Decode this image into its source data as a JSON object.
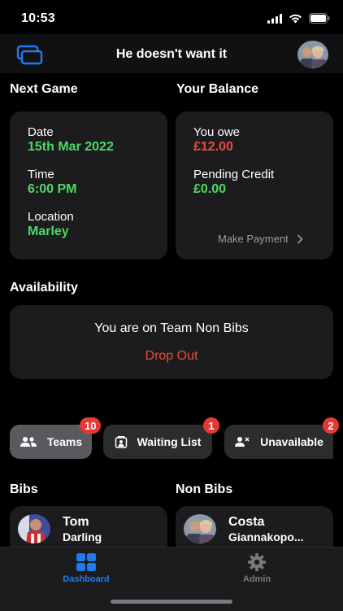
{
  "status": {
    "time": "10:53"
  },
  "header": {
    "title": "He doesn't want it"
  },
  "next_game": {
    "title": "Next Game",
    "date_label": "Date",
    "date_value": "15th Mar 2022",
    "time_label": "Time",
    "time_value": "6:00 PM",
    "location_label": "Location",
    "location_value": "Marley"
  },
  "balance": {
    "title": "Your Balance",
    "owe_label": "You owe",
    "owe_value": "£12.00",
    "credit_label": "Pending Credit",
    "credit_value": "£0.00",
    "make_payment": "Make Payment"
  },
  "availability": {
    "title": "Availability",
    "team_text": "You are on Team Non Bibs",
    "drop_out": "Drop Out"
  },
  "chips": [
    {
      "label": "Teams",
      "badge": "10",
      "icon": "people-icon"
    },
    {
      "label": "Waiting List",
      "badge": "1",
      "icon": "waiting-list-icon"
    },
    {
      "label": "Unavailable",
      "badge": "2",
      "icon": "person-unavailable-icon"
    }
  ],
  "teams": {
    "bibs_title": "Bibs",
    "non_bibs_title": "Non Bibs",
    "bibs_player": {
      "first": "Tom",
      "last": "Darling"
    },
    "non_bibs_player": {
      "first": "Costa",
      "last": "Giannakopo..."
    }
  },
  "tabbar": {
    "dashboard": "Dashboard",
    "admin": "Admin"
  },
  "colors": {
    "accent_blue": "#1e7cf2",
    "green": "#4cd964",
    "red": "#e74c3c",
    "badge_red": "#e53935"
  }
}
